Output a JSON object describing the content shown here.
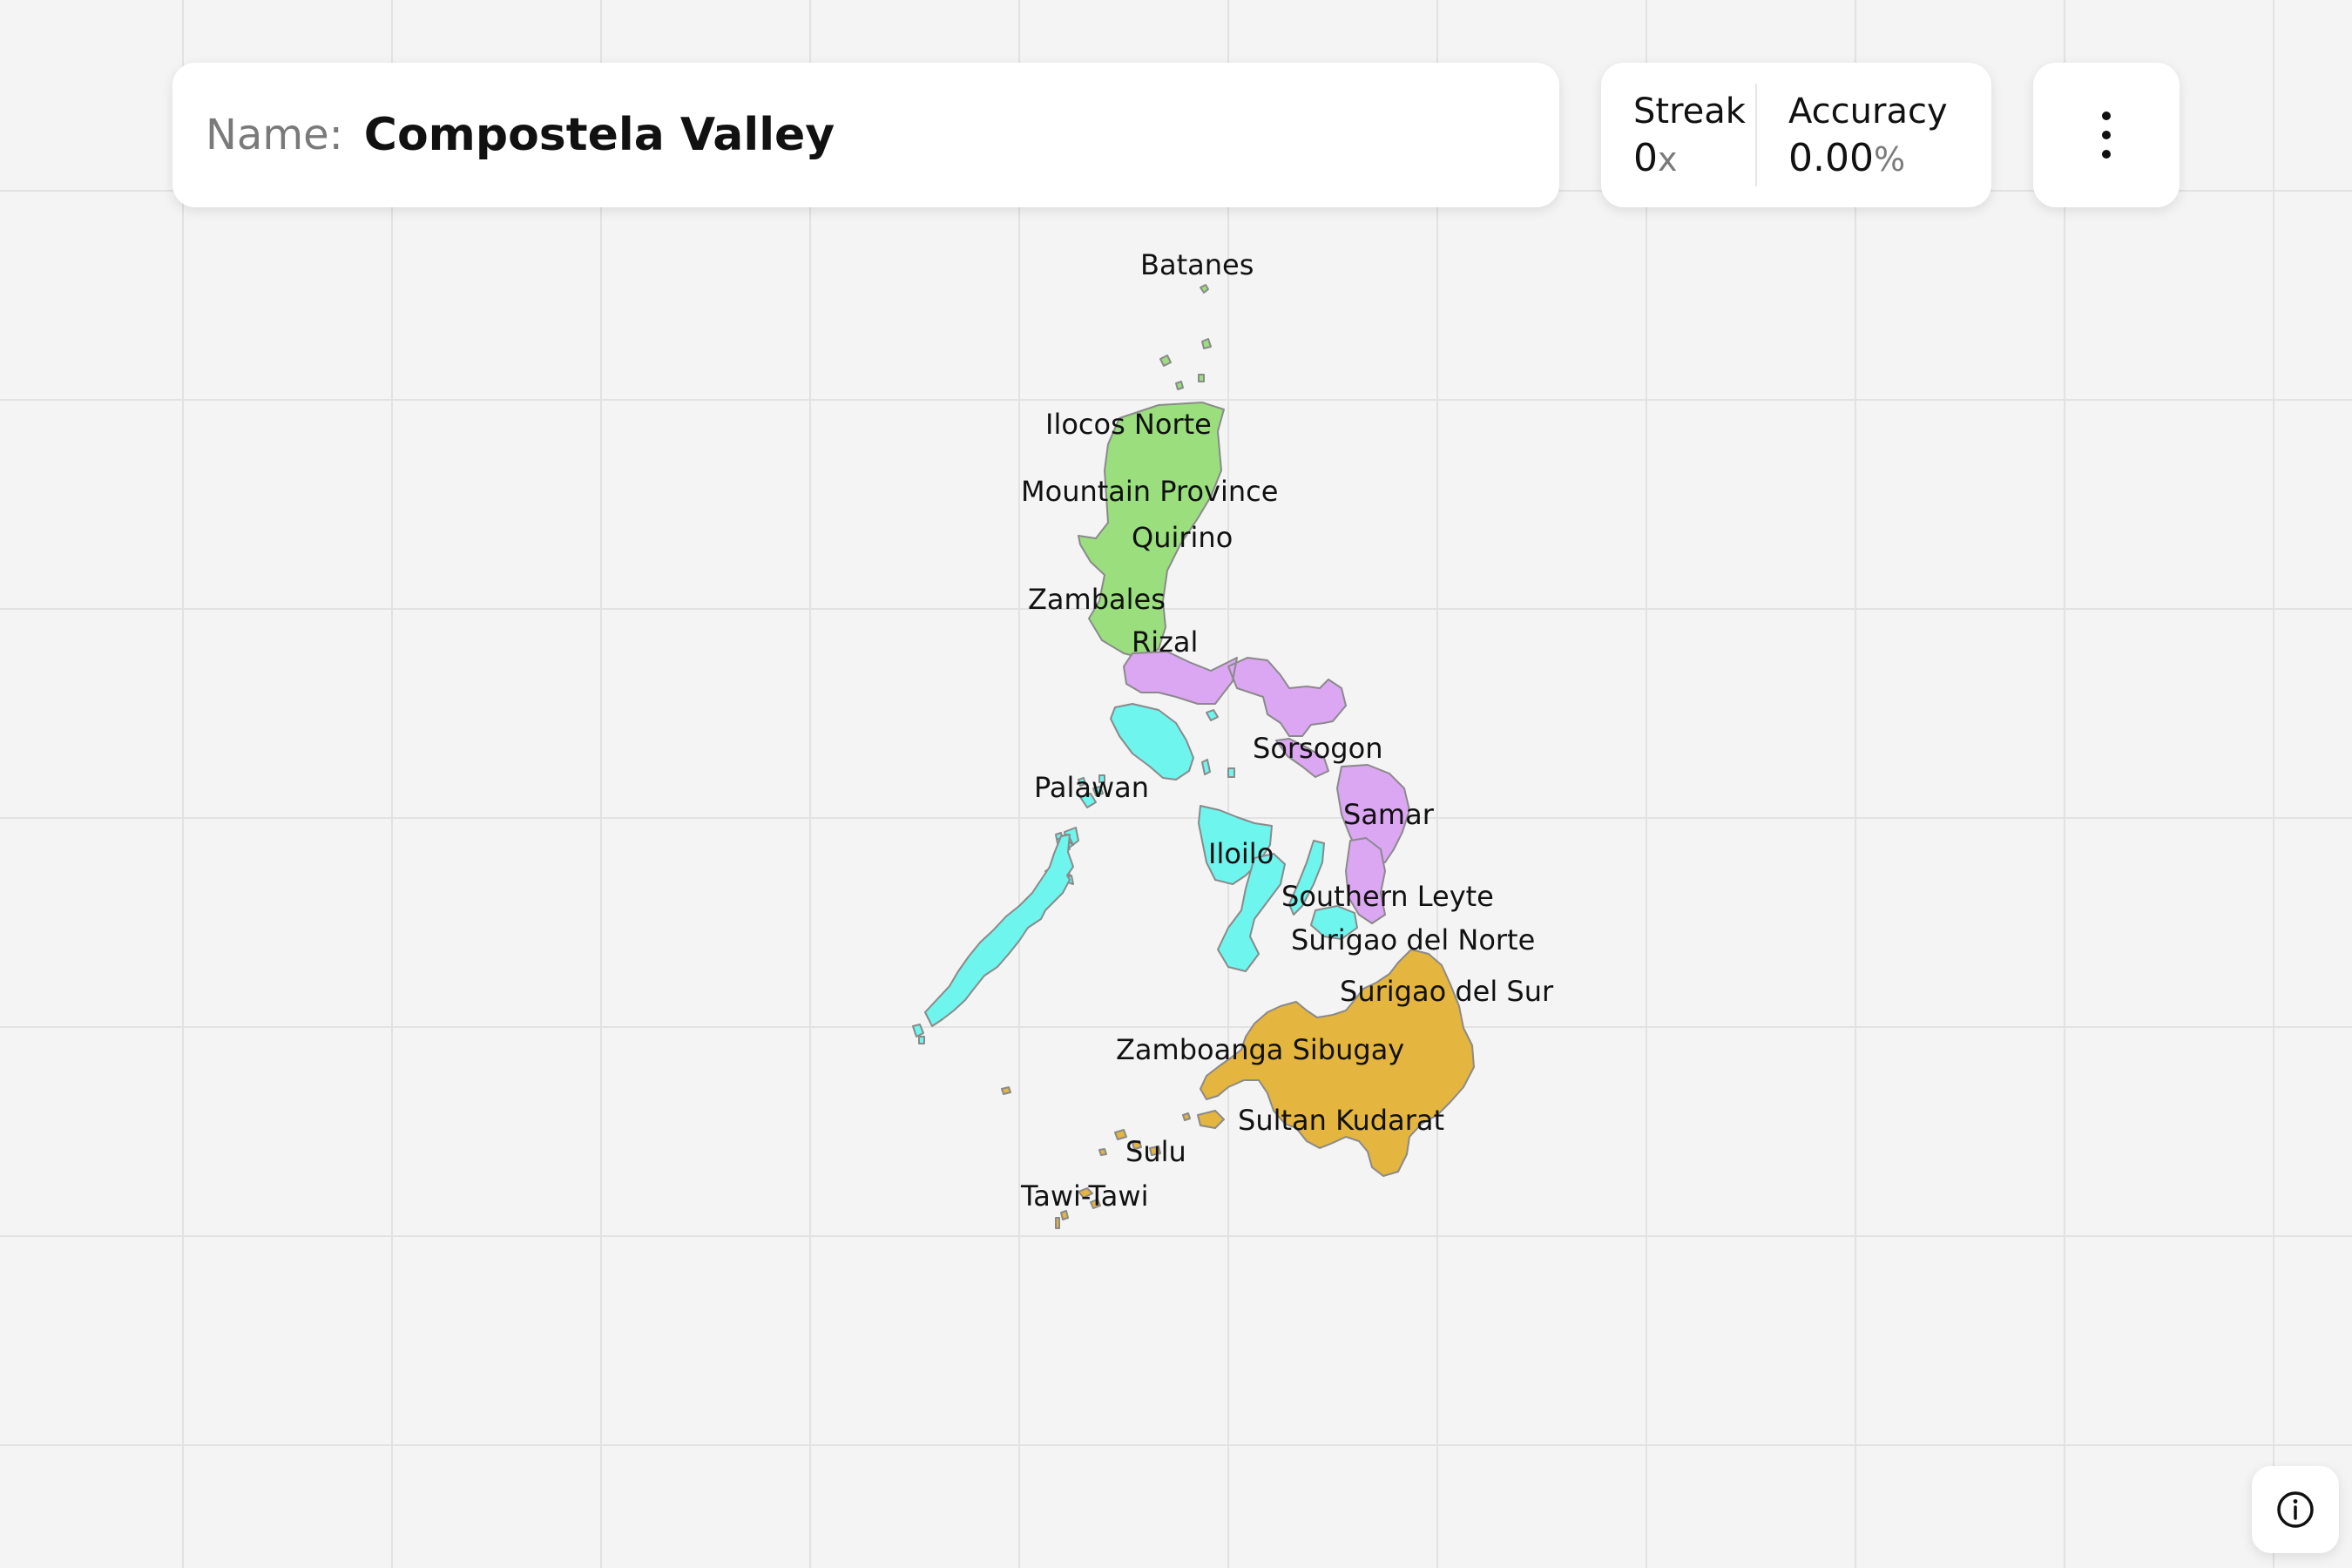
{
  "header": {
    "name_label": "Name:",
    "name_value": "Compostela Valley"
  },
  "stats": {
    "streak_label": "Streak",
    "streak_value": "0",
    "streak_unit": "x",
    "accuracy_label": "Accuracy",
    "accuracy_value": "0.00",
    "accuracy_unit": "%"
  },
  "icons": {
    "menu": "more-vertical-icon",
    "info": "info-icon"
  },
  "colors": {
    "luzon": "#9bde7e",
    "southern_luzon": "#dba6f2",
    "visayas": "#6ef5ee",
    "mindanao": "#e4b53f",
    "outline": "#8a8a8a",
    "background": "#f4f4f4"
  },
  "map": {
    "labels": [
      "Batanes",
      "Ilocos Norte",
      "Mountain Province",
      "Quirino",
      "Zambales",
      "Rizal",
      "Sorsogon",
      "Palawan",
      "Samar",
      "Iloilo",
      "Southern Leyte",
      "Surigao del Norte",
      "Surigao del Sur",
      "Zamboanga Sibugay",
      "Sultan Kudarat",
      "Sulu",
      "Tawi-Tawi"
    ]
  }
}
